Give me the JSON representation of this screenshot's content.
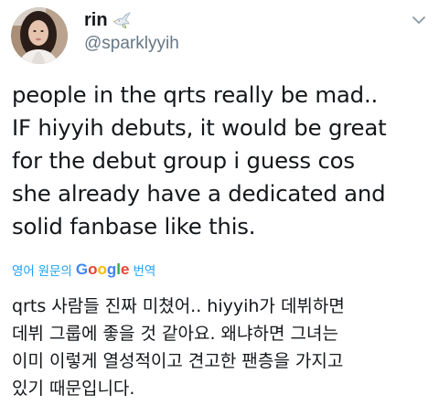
{
  "user": {
    "display_name": "rin",
    "name_emoji": "dove-emoji",
    "handle": "@sparklyyih"
  },
  "tweet": {
    "lines": [
      "people in the qrts really be mad..",
      "IF hiyyih debuts, it would be great",
      "for the debut group i guess cos",
      "she already have a dedicated and",
      "solid fanbase like this."
    ]
  },
  "translation": {
    "prefix": "영어 원문의",
    "google_letters": [
      "G",
      "o",
      "o",
      "g",
      "l",
      "e"
    ],
    "suffix": "번역",
    "lines": [
      "qrts 사람들 진짜 미쳤어.. hiyyih가 데뷔하면",
      "데뷔 그룹에 좋을 것 같아요. 왜냐하면 그녀는",
      "이미 이렇게 열성적이고 견고한 팬층을 가지고",
      "있기 때문입니다."
    ]
  },
  "icons": {
    "caret": "chevron-down-icon",
    "avatar": "avatar"
  },
  "colors": {
    "text_primary": "#14171a",
    "text_secondary": "#657786",
    "link_blue": "#1da1f2"
  }
}
